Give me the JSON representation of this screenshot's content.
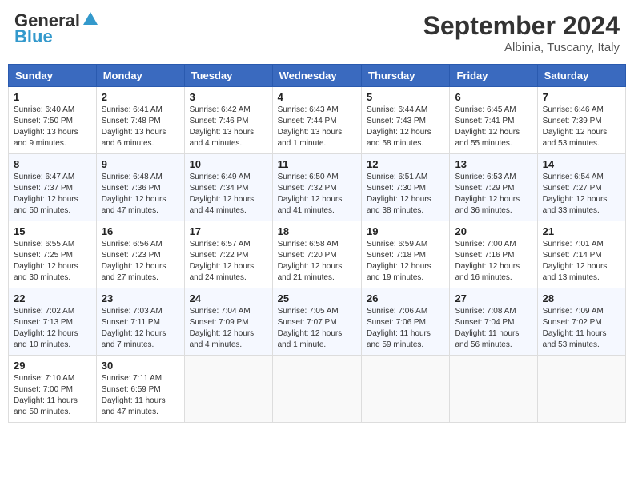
{
  "header": {
    "logo_line1": "General",
    "logo_line2": "Blue",
    "month": "September 2024",
    "location": "Albinia, Tuscany, Italy"
  },
  "days_of_week": [
    "Sunday",
    "Monday",
    "Tuesday",
    "Wednesday",
    "Thursday",
    "Friday",
    "Saturday"
  ],
  "weeks": [
    [
      {
        "day": "1",
        "info": "Sunrise: 6:40 AM\nSunset: 7:50 PM\nDaylight: 13 hours\nand 9 minutes."
      },
      {
        "day": "2",
        "info": "Sunrise: 6:41 AM\nSunset: 7:48 PM\nDaylight: 13 hours\nand 6 minutes."
      },
      {
        "day": "3",
        "info": "Sunrise: 6:42 AM\nSunset: 7:46 PM\nDaylight: 13 hours\nand 4 minutes."
      },
      {
        "day": "4",
        "info": "Sunrise: 6:43 AM\nSunset: 7:44 PM\nDaylight: 13 hours\nand 1 minute."
      },
      {
        "day": "5",
        "info": "Sunrise: 6:44 AM\nSunset: 7:43 PM\nDaylight: 12 hours\nand 58 minutes."
      },
      {
        "day": "6",
        "info": "Sunrise: 6:45 AM\nSunset: 7:41 PM\nDaylight: 12 hours\nand 55 minutes."
      },
      {
        "day": "7",
        "info": "Sunrise: 6:46 AM\nSunset: 7:39 PM\nDaylight: 12 hours\nand 53 minutes."
      }
    ],
    [
      {
        "day": "8",
        "info": "Sunrise: 6:47 AM\nSunset: 7:37 PM\nDaylight: 12 hours\nand 50 minutes."
      },
      {
        "day": "9",
        "info": "Sunrise: 6:48 AM\nSunset: 7:36 PM\nDaylight: 12 hours\nand 47 minutes."
      },
      {
        "day": "10",
        "info": "Sunrise: 6:49 AM\nSunset: 7:34 PM\nDaylight: 12 hours\nand 44 minutes."
      },
      {
        "day": "11",
        "info": "Sunrise: 6:50 AM\nSunset: 7:32 PM\nDaylight: 12 hours\nand 41 minutes."
      },
      {
        "day": "12",
        "info": "Sunrise: 6:51 AM\nSunset: 7:30 PM\nDaylight: 12 hours\nand 38 minutes."
      },
      {
        "day": "13",
        "info": "Sunrise: 6:53 AM\nSunset: 7:29 PM\nDaylight: 12 hours\nand 36 minutes."
      },
      {
        "day": "14",
        "info": "Sunrise: 6:54 AM\nSunset: 7:27 PM\nDaylight: 12 hours\nand 33 minutes."
      }
    ],
    [
      {
        "day": "15",
        "info": "Sunrise: 6:55 AM\nSunset: 7:25 PM\nDaylight: 12 hours\nand 30 minutes."
      },
      {
        "day": "16",
        "info": "Sunrise: 6:56 AM\nSunset: 7:23 PM\nDaylight: 12 hours\nand 27 minutes."
      },
      {
        "day": "17",
        "info": "Sunrise: 6:57 AM\nSunset: 7:22 PM\nDaylight: 12 hours\nand 24 minutes."
      },
      {
        "day": "18",
        "info": "Sunrise: 6:58 AM\nSunset: 7:20 PM\nDaylight: 12 hours\nand 21 minutes."
      },
      {
        "day": "19",
        "info": "Sunrise: 6:59 AM\nSunset: 7:18 PM\nDaylight: 12 hours\nand 19 minutes."
      },
      {
        "day": "20",
        "info": "Sunrise: 7:00 AM\nSunset: 7:16 PM\nDaylight: 12 hours\nand 16 minutes."
      },
      {
        "day": "21",
        "info": "Sunrise: 7:01 AM\nSunset: 7:14 PM\nDaylight: 12 hours\nand 13 minutes."
      }
    ],
    [
      {
        "day": "22",
        "info": "Sunrise: 7:02 AM\nSunset: 7:13 PM\nDaylight: 12 hours\nand 10 minutes."
      },
      {
        "day": "23",
        "info": "Sunrise: 7:03 AM\nSunset: 7:11 PM\nDaylight: 12 hours\nand 7 minutes."
      },
      {
        "day": "24",
        "info": "Sunrise: 7:04 AM\nSunset: 7:09 PM\nDaylight: 12 hours\nand 4 minutes."
      },
      {
        "day": "25",
        "info": "Sunrise: 7:05 AM\nSunset: 7:07 PM\nDaylight: 12 hours\nand 1 minute."
      },
      {
        "day": "26",
        "info": "Sunrise: 7:06 AM\nSunset: 7:06 PM\nDaylight: 11 hours\nand 59 minutes."
      },
      {
        "day": "27",
        "info": "Sunrise: 7:08 AM\nSunset: 7:04 PM\nDaylight: 11 hours\nand 56 minutes."
      },
      {
        "day": "28",
        "info": "Sunrise: 7:09 AM\nSunset: 7:02 PM\nDaylight: 11 hours\nand 53 minutes."
      }
    ],
    [
      {
        "day": "29",
        "info": "Sunrise: 7:10 AM\nSunset: 7:00 PM\nDaylight: 11 hours\nand 50 minutes."
      },
      {
        "day": "30",
        "info": "Sunrise: 7:11 AM\nSunset: 6:59 PM\nDaylight: 11 hours\nand 47 minutes."
      },
      {
        "day": "",
        "info": ""
      },
      {
        "day": "",
        "info": ""
      },
      {
        "day": "",
        "info": ""
      },
      {
        "day": "",
        "info": ""
      },
      {
        "day": "",
        "info": ""
      }
    ]
  ]
}
